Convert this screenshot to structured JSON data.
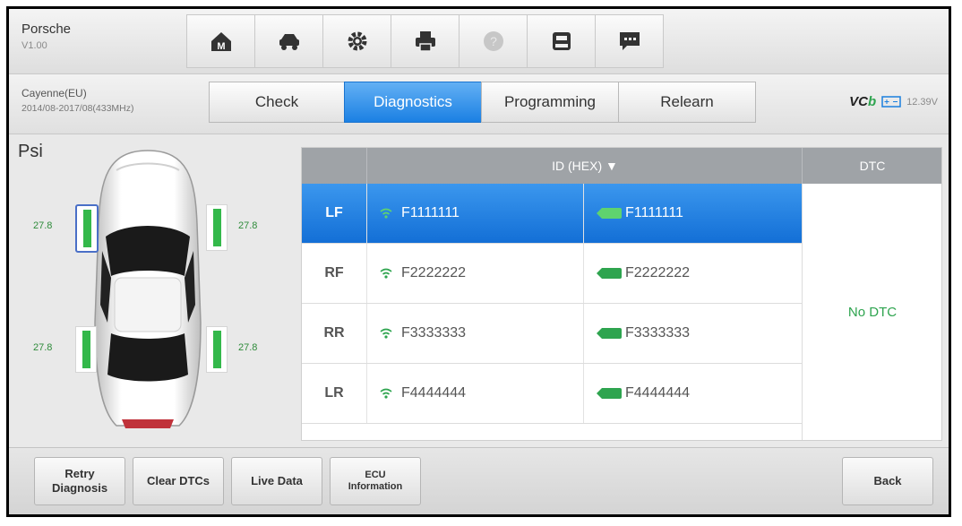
{
  "header": {
    "brand": "Porsche",
    "version": "V1.00"
  },
  "toolbar": {
    "icons": [
      "home-icon",
      "vehicle-icon",
      "settings-icon",
      "print-icon",
      "help-icon",
      "save-icon",
      "message-icon"
    ]
  },
  "vehicle": {
    "model": "Cayenne(EU)",
    "details": "2014/08-2017/08(433MHz)"
  },
  "tabs": [
    {
      "label": "Check",
      "active": false
    },
    {
      "label": "Diagnostics",
      "active": true
    },
    {
      "label": "Programming",
      "active": false
    },
    {
      "label": "Relearn",
      "active": false
    }
  ],
  "status": {
    "vci": "VC",
    "vci_b": "b",
    "voltage": "12.39V"
  },
  "main": {
    "unit": "Psi",
    "tires": {
      "lf": "27.8",
      "rf": "27.8",
      "lr": "27.8",
      "rr": "27.8"
    }
  },
  "table": {
    "header_id": "ID (HEX) ▼",
    "header_dtc": "DTC",
    "dtc_value": "No DTC",
    "rows": [
      {
        "pos": "LF",
        "sensor_id": "F1111111",
        "tag_id": "F1111111",
        "selected": true
      },
      {
        "pos": "RF",
        "sensor_id": "F2222222",
        "tag_id": "F2222222",
        "selected": false
      },
      {
        "pos": "RR",
        "sensor_id": "F3333333",
        "tag_id": "F3333333",
        "selected": false
      },
      {
        "pos": "LR",
        "sensor_id": "F4444444",
        "tag_id": "F4444444",
        "selected": false
      }
    ]
  },
  "bottom": {
    "retry_line1": "Retry",
    "retry_line2": "Diagnosis",
    "clear": "Clear DTCs",
    "live": "Live Data",
    "ecu_line1": "ECU",
    "ecu_line2": "Information",
    "back": "Back"
  },
  "colors": {
    "accent": "#1b80e3",
    "ok": "#2ea44f",
    "tire": "#33b84a"
  }
}
